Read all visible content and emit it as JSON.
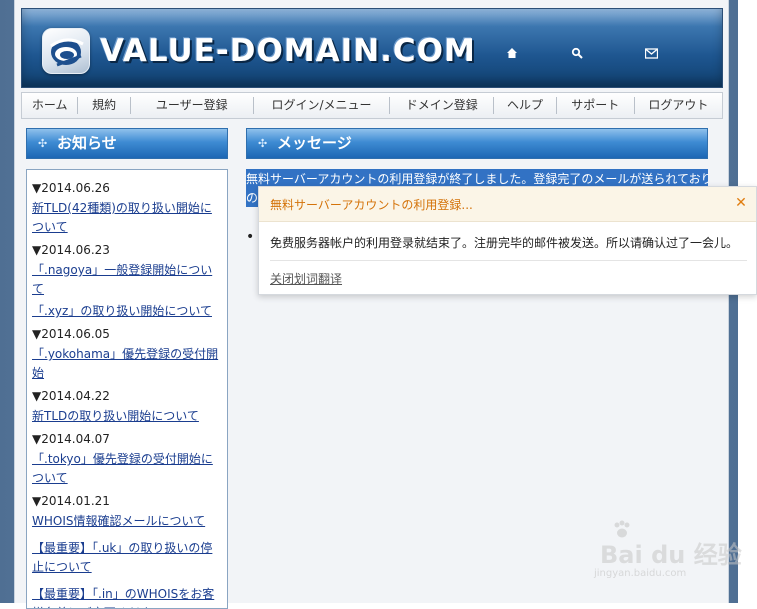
{
  "header": {
    "logo_text": "VALUE-DOMAIN.COM",
    "icons": [
      "home-icon",
      "search-icon",
      "mail-icon"
    ]
  },
  "nav": {
    "items": [
      {
        "label": "ホーム"
      },
      {
        "label": "規約"
      },
      {
        "label": "ユーザー登録"
      },
      {
        "label": "ログイン/メニュー"
      },
      {
        "label": "ドメイン登録"
      },
      {
        "label": "ヘルプ"
      },
      {
        "label": "サポート"
      },
      {
        "label": "ログアウト"
      }
    ]
  },
  "news": {
    "title": "お知らせ",
    "entries": [
      {
        "date": "▼2014.06.26",
        "links": [
          "新TLD(42種類)の取り扱い開始について"
        ]
      },
      {
        "date": "▼2014.06.23",
        "links": [
          "「.nagoya」一般登録開始について",
          "「.xyz」の取り扱い開始について"
        ]
      },
      {
        "date": "▼2014.06.05",
        "links": [
          "「.yokohama」優先登録の受付開始"
        ]
      },
      {
        "date": "▼2014.04.22",
        "links": [
          "新TLDの取り扱い開始について"
        ]
      },
      {
        "date": "▼2014.04.07",
        "links": [
          "「.tokyo」優先登録の受付開始について"
        ]
      },
      {
        "date": "▼2014.01.21",
        "links": [
          "WHOIS情報確認メールについて"
        ]
      }
    ],
    "extra_links": [
      "【最重要】「.uk」の取り扱いの停止について",
      "【最重要】「.in」のWHOISをお客様名義にご変更ください"
    ]
  },
  "message": {
    "title": "メッセージ",
    "selected_text": "無料サーバーアカウントの利用登録が終了しました。登録完了のメールが送られておりますので",
    "selected_text_cont": "の"
  },
  "popup": {
    "title": "無料サーバーアカウントの利用登録...",
    "translation": "免费服务器帐户的利用登录就结束了。注册完毕的邮件被发送。所以请确认过了一会儿。",
    "close_link": "关闭划词翻译"
  },
  "watermark": {
    "brand": "Bai du 经验",
    "url": "jingyan.baidu.com"
  },
  "colors": {
    "header_blue": "#1e5690",
    "panel_blue": "#3e8bd3",
    "selection_blue": "#3272c4",
    "link_blue": "#1a3d8f",
    "popup_orange": "#d4730a"
  }
}
